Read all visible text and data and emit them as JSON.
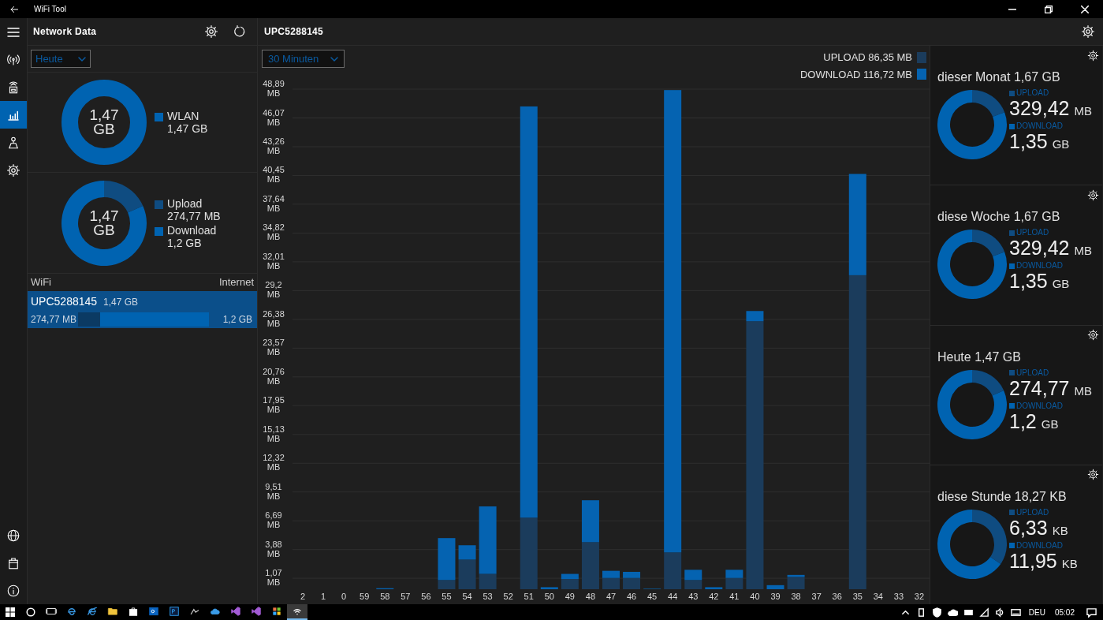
{
  "window": {
    "title": "WiFi Tool"
  },
  "nav_top": [
    {
      "kind": "antenna",
      "selected": false
    },
    {
      "kind": "router",
      "selected": false
    },
    {
      "kind": "chart",
      "selected": true
    },
    {
      "kind": "person",
      "selected": false
    },
    {
      "kind": "settings",
      "selected": false
    }
  ],
  "nav_bottom": [
    {
      "kind": "globe",
      "selected": false
    },
    {
      "kind": "bag",
      "selected": false
    },
    {
      "kind": "info",
      "selected": false
    }
  ],
  "left_panel": {
    "title": "Network Data",
    "period": "Heute",
    "total_donut": {
      "center_value": "1,47",
      "center_unit": "GB",
      "legend_labels": [
        "WLAN"
      ],
      "legend_values": [
        "1,47 GB"
      ]
    },
    "split_donut": {
      "center_value": "1,47",
      "center_unit": "GB",
      "legend_values": [
        "274,77 MB",
        "1,2 GB"
      ],
      "chart_data": {
        "type": "donut",
        "categories": [
          "Upload",
          "Download"
        ],
        "values": [
          18.3,
          81.7
        ]
      }
    },
    "list_headers": [
      "WiFi",
      "Internet"
    ],
    "networks": [
      {
        "name": "UPC5288145",
        "total": "1,47 GB",
        "upload": "274,77 MB",
        "download": "1,2 GB",
        "level": 0.17,
        "selected": true
      }
    ]
  },
  "main": {
    "title": "UPC5288145",
    "period": "30 Minuten",
    "legend_totals": [
      "86,35 MB",
      "116,72 MB"
    ],
    "chart_data": {
      "type": "bar",
      "stacked": true,
      "categories": [
        "2",
        "1",
        "0",
        "59",
        "58",
        "57",
        "56",
        "55",
        "54",
        "53",
        "52",
        "51",
        "50",
        "49",
        "48",
        "47",
        "46",
        "45",
        "44",
        "43",
        "42",
        "41",
        "40",
        "39",
        "38",
        "37",
        "36",
        "35",
        "34",
        "33",
        "32"
      ],
      "series": [
        {
          "name": "UPLOAD",
          "color": "#1b3c5c",
          "values": [
            0,
            0,
            0,
            0,
            0,
            0,
            0,
            0.9,
            2.9,
            1.5,
            0,
            7.0,
            null,
            1.0,
            4.6,
            1.1,
            1.1,
            0,
            3.6,
            0.9,
            0,
            1.1,
            26.2,
            null,
            1.2,
            0,
            0,
            30.7,
            0,
            0,
            0
          ]
        },
        {
          "name": "DOWNLOAD",
          "color": "#0563b1",
          "values": [
            0,
            0,
            0,
            0,
            0.1,
            0,
            0,
            4.1,
            1.4,
            6.6,
            0,
            40.2,
            0.2,
            0.5,
            4.1,
            0.7,
            0.6,
            0.05,
            45.2,
            1.0,
            0.2,
            0.8,
            1.0,
            0.4,
            0.2,
            0,
            0,
            9.9,
            0,
            0,
            0
          ]
        }
      ],
      "ylim": [
        0,
        48.89
      ],
      "grid": true,
      "yticks": [
        {
          "value": 1.07,
          "label": "1,07 MB"
        },
        {
          "value": 3.88,
          "label": "3,88 MB"
        },
        {
          "value": 6.69,
          "label": "6,69 MB"
        },
        {
          "value": 9.51,
          "label": "9,51 MB"
        },
        {
          "value": 12.32,
          "label": "12,32 MB"
        },
        {
          "value": 15.13,
          "label": "15,13 MB"
        },
        {
          "value": 17.95,
          "label": "17,95 MB"
        },
        {
          "value": 20.76,
          "label": "20,76 MB"
        },
        {
          "value": 23.57,
          "label": "23,57 MB"
        },
        {
          "value": 26.38,
          "label": "26,38 MB"
        },
        {
          "value": 29.2,
          "label": "29,2 MB"
        },
        {
          "value": 32.01,
          "label": "32,01 MB"
        },
        {
          "value": 34.82,
          "label": "34,82 MB"
        },
        {
          "value": 37.64,
          "label": "37,64 MB"
        },
        {
          "value": 40.45,
          "label": "40,45 MB"
        },
        {
          "value": 43.26,
          "label": "43,26 MB"
        },
        {
          "value": 46.07,
          "label": "46,07 MB"
        },
        {
          "value": 48.89,
          "label": "48,89 MB"
        }
      ]
    }
  },
  "summary_cards": [
    {
      "title": "dieser Monat 1,67 GB",
      "amounts": [
        {
          "value": "329,42",
          "unit": "MB"
        },
        {
          "value": "1,35",
          "unit": "GB"
        }
      ],
      "chart_data": {
        "type": "donut",
        "categories": [
          "UPLOAD",
          "DOWNLOAD"
        ],
        "values": [
          19.2,
          80.8
        ]
      }
    },
    {
      "title": "diese Woche 1,67 GB",
      "amounts": [
        {
          "value": "329,42",
          "unit": "MB"
        },
        {
          "value": "1,35",
          "unit": "GB"
        }
      ],
      "chart_data": {
        "type": "donut",
        "categories": [
          "UPLOAD",
          "DOWNLOAD"
        ],
        "values": [
          19.2,
          80.8
        ]
      }
    },
    {
      "title": "Heute 1,47 GB",
      "amounts": [
        {
          "value": "274,77",
          "unit": "MB"
        },
        {
          "value": "1,2",
          "unit": "GB"
        }
      ],
      "chart_data": {
        "type": "donut",
        "categories": [
          "UPLOAD",
          "DOWNLOAD"
        ],
        "values": [
          18.3,
          81.7
        ]
      }
    },
    {
      "title": "diese Stunde 18,27 KB",
      "amounts": [
        {
          "value": "6,33",
          "unit": "KB"
        },
        {
          "value": "11,95",
          "unit": "KB"
        }
      ],
      "chart_data": {
        "type": "donut",
        "categories": [
          "UPLOAD",
          "DOWNLOAD"
        ],
        "values": [
          34.6,
          65.4
        ]
      }
    }
  ],
  "taskbar": {
    "apps": [
      {
        "kind": "taskview",
        "selected": false
      },
      {
        "kind": "edge",
        "selected": false
      },
      {
        "kind": "ie",
        "selected": false
      },
      {
        "kind": "folder",
        "selected": false
      },
      {
        "kind": "store",
        "selected": false
      },
      {
        "kind": "outlook",
        "selected": false
      },
      {
        "kind": "photoshop",
        "selected": false
      },
      {
        "kind": "app",
        "selected": false
      },
      {
        "kind": "cloud",
        "selected": false
      },
      {
        "kind": "vs",
        "selected": false
      },
      {
        "kind": "vs",
        "selected": false
      },
      {
        "kind": "tiles",
        "selected": false
      },
      {
        "kind": "wifitool",
        "selected": true
      }
    ],
    "language": "DEU",
    "time": "05:02"
  }
}
